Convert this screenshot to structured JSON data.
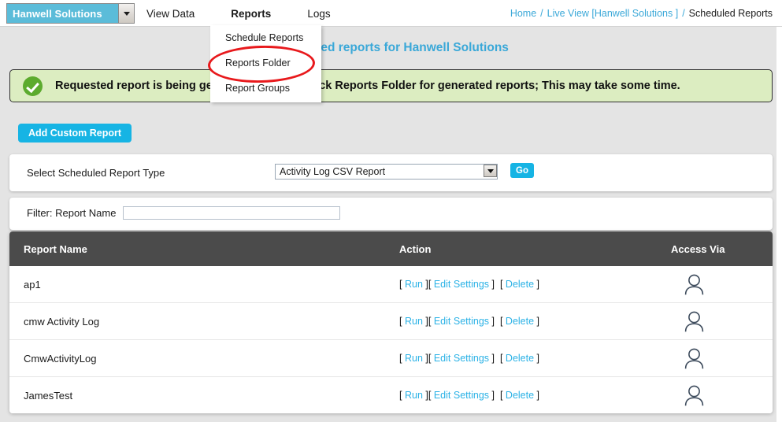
{
  "topbar": {
    "org_select": {
      "value": "Hanwell Solutions",
      "arrow_icon": "chevron-down-icon"
    },
    "nav": [
      {
        "label": "View Data",
        "active": false
      },
      {
        "label": "Reports",
        "active": true
      },
      {
        "label": "Logs",
        "active": false
      }
    ],
    "breadcrumb": {
      "home": "Home",
      "sep": "/",
      "live_view": "Live View [Hanwell Solutions ]",
      "current": "Scheduled Reports"
    }
  },
  "menu": {
    "items": [
      {
        "label": "Schedule Reports"
      },
      {
        "label": "Reports Folder"
      },
      {
        "label": "Report Groups"
      }
    ]
  },
  "page": {
    "title": "Scheduled reports for Hanwell Solutions",
    "title_color": "#3aa8d8"
  },
  "alert": {
    "icon": "check-circle-icon",
    "icon_color": "#5cab2e",
    "background": "#dcedc1",
    "message": "Requested report is being generated. Please check Reports Folder for generated reports; This may take some time."
  },
  "toolbar": {
    "add_custom_report_label": "Add Custom Report",
    "accent_color": "#16b4e4"
  },
  "report_type": {
    "label": "Select Scheduled Report Type",
    "selected": "Activity Log CSV Report",
    "arrow_icon": "chevron-down-icon",
    "go_label": "Go"
  },
  "filter": {
    "label": "Filter: Report Name",
    "value": "",
    "placeholder": ""
  },
  "table": {
    "columns": [
      "Report Name",
      "Action",
      "Access Via"
    ],
    "actions": {
      "open_bracket": "[",
      "close_bracket": "]",
      "run": "Run",
      "edit_settings": "Edit Settings",
      "delete": "Delete"
    },
    "access_icon": "person-icon",
    "rows": [
      {
        "name": "ap1"
      },
      {
        "name": "cmw Activity Log"
      },
      {
        "name": "CmwActivityLog"
      },
      {
        "name": "JamesTest"
      }
    ]
  }
}
